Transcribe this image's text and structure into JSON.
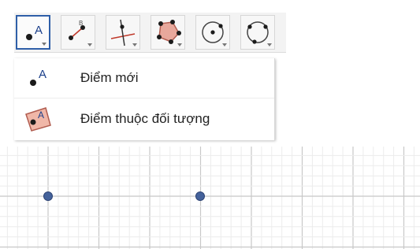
{
  "toolbar": {
    "tools": [
      {
        "icon": "point-icon",
        "active": true
      },
      {
        "icon": "segment-icon",
        "active": false
      },
      {
        "icon": "perpendicular-line-icon",
        "active": false
      },
      {
        "icon": "polygon-icon",
        "active": false
      },
      {
        "icon": "circle-center-point-icon",
        "active": false
      },
      {
        "icon": "circle-three-points-icon",
        "active": false
      }
    ]
  },
  "dropdown": {
    "items": [
      {
        "label": "Điểm mới",
        "icon": "point-icon"
      },
      {
        "label": "Điểm thuộc đối tượng",
        "icon": "point-on-object-icon"
      }
    ]
  },
  "colors": {
    "active_border": "#2f5fa8",
    "point_fill": "#44629b",
    "grid_major": "#c8c8c8",
    "grid_minor": "#ececec"
  }
}
